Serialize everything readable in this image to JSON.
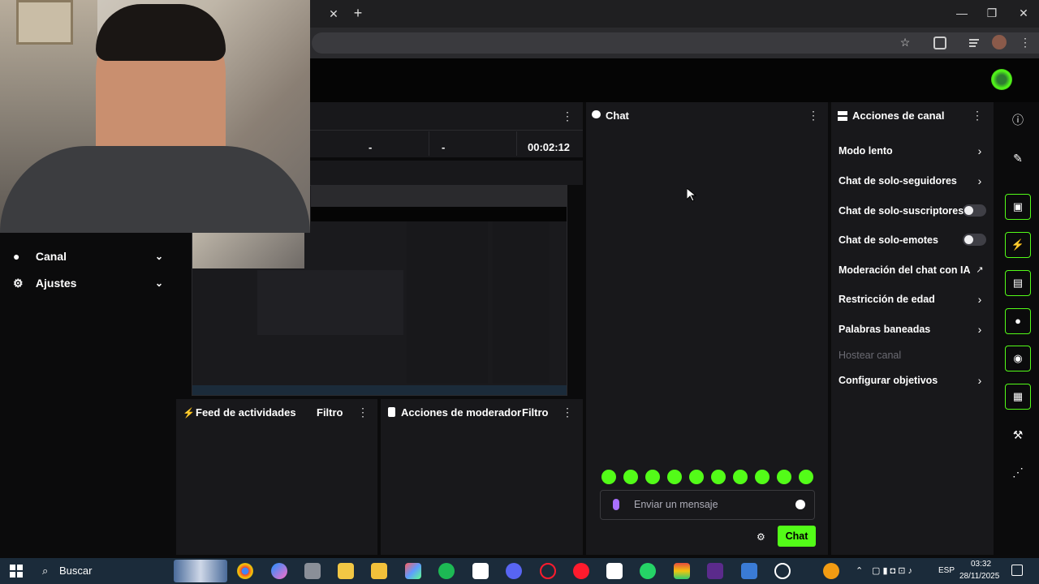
{
  "browser": {
    "close_tab": "✕",
    "new_tab": "+",
    "minimize": "—",
    "maximize": "❐",
    "close_window": "✕"
  },
  "stream": {
    "stat1": "-",
    "stat2": "-",
    "uptime": "00:02:12"
  },
  "sidebar": {
    "items": [
      {
        "label": "Canal"
      },
      {
        "label": "Ajustes"
      }
    ]
  },
  "chat": {
    "title": "Chat",
    "placeholder": "Enviar un mensaje",
    "send_label": "Chat"
  },
  "channel_actions": {
    "title": "Acciones de canal",
    "items": [
      {
        "label": "Modo lento"
      },
      {
        "label": "Chat de solo-seguidores"
      },
      {
        "label": "Chat de solo-suscriptores"
      },
      {
        "label": "Chat de solo-emotes"
      },
      {
        "label": "Moderación del chat con IA"
      },
      {
        "label": "Restricción de edad"
      },
      {
        "label": "Palabras baneadas"
      },
      {
        "label": "Hostear canal"
      },
      {
        "label": "Configurar objetivos"
      }
    ]
  },
  "activity_feed": {
    "title": "Feed de actividades",
    "filter": "Filtro"
  },
  "mod_actions": {
    "title": "Acciones de moderador",
    "filter": "Filtro"
  },
  "taskbar": {
    "search": "Buscar",
    "lang": "ESP",
    "time": "03:32",
    "date": "28/11/2025"
  },
  "colors": {
    "accent": "#53fc18",
    "panel": "#18181b"
  }
}
